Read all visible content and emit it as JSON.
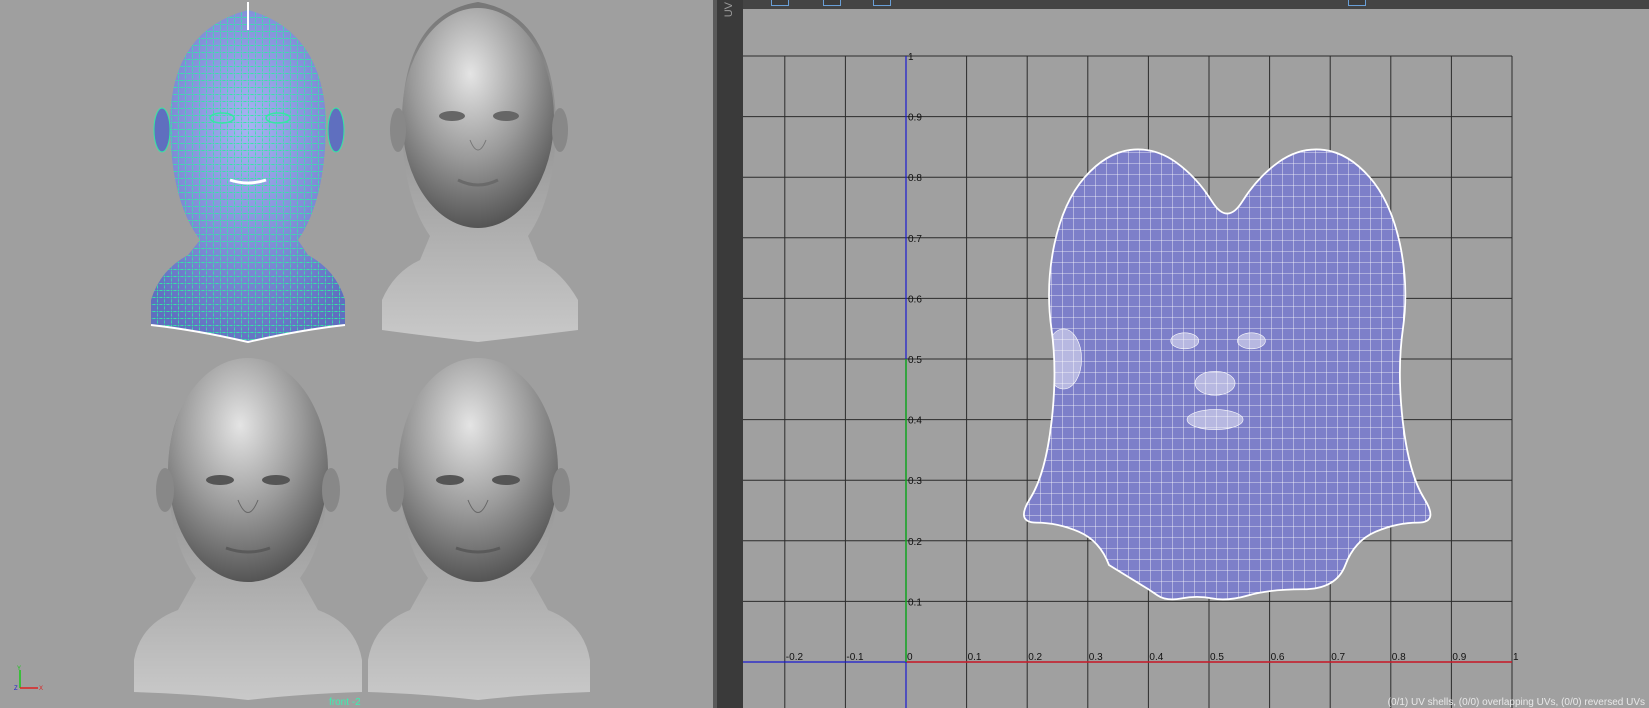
{
  "viewport": {
    "camera_label": "front -2",
    "heads": [
      {
        "name": "female-head-wireframe",
        "state": "selected"
      },
      {
        "name": "female-head-shaded",
        "state": "shaded"
      },
      {
        "name": "male-head-shaded-1",
        "state": "shaded"
      },
      {
        "name": "male-head-shaded-2",
        "state": "shaded"
      }
    ],
    "axis_gizmo": {
      "y": "Y",
      "z": "Z",
      "x": "X"
    }
  },
  "uv_panel": {
    "tab_label": "UV",
    "x_ticks": [
      "-0.2",
      "-0.1",
      "0",
      "0.1",
      "0.2",
      "0.3",
      "0.4",
      "0.5",
      "0.6",
      "0.7",
      "0.8",
      "0.9",
      "1"
    ],
    "y_ticks": [
      "0.1",
      "0.2",
      "0.3",
      "0.4",
      "0.5",
      "0.6",
      "0.7",
      "0.8",
      "0.9",
      "1"
    ],
    "status_text": "(0/1) UV shells, (0/0) overlapping UVs, (0/0) reversed UVs",
    "colors": {
      "uv_fill": "#7d7fc9",
      "grid": "#2b2b2b",
      "u_axis": "#d22020",
      "v_axis": "#12b012",
      "axis_blue": "#1a1ad0",
      "selection_wire": "#3cf0b0"
    }
  }
}
